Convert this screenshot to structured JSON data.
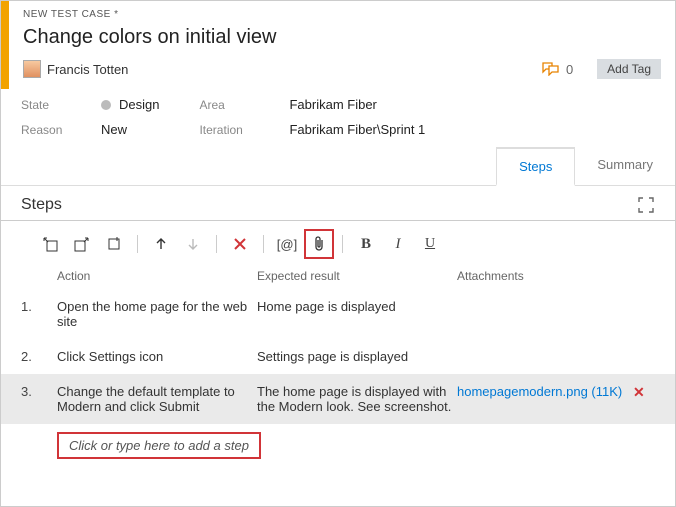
{
  "breadcrumb": "NEW TEST CASE *",
  "title": "Change colors on initial view",
  "owner": "Francis Totten",
  "discussion_count": "0",
  "add_tag_label": "Add Tag",
  "fields": {
    "state_label": "State",
    "state_value": "Design",
    "reason_label": "Reason",
    "reason_value": "New",
    "area_label": "Area",
    "area_value": "Fabrikam Fiber",
    "iteration_label": "Iteration",
    "iteration_value": "Fabrikam Fiber\\Sprint 1"
  },
  "tabs": {
    "steps": "Steps",
    "summary": "Summary"
  },
  "section_title": "Steps",
  "columns": {
    "action": "Action",
    "expected": "Expected result",
    "attachments": "Attachments"
  },
  "steps": [
    {
      "num": "1.",
      "action": "Open the home page for the web site",
      "expected": "Home page is displayed",
      "attachment": ""
    },
    {
      "num": "2.",
      "action": "Click Settings icon",
      "expected": "Settings page is displayed",
      "attachment": ""
    },
    {
      "num": "3.",
      "action": "Change the default template to Modern and click Submit",
      "expected": "The home page is displayed with the Modern look. See screenshot.",
      "attachment": "homepagemodern.png (11K)"
    }
  ],
  "add_step_placeholder": "Click or type here to add a step"
}
